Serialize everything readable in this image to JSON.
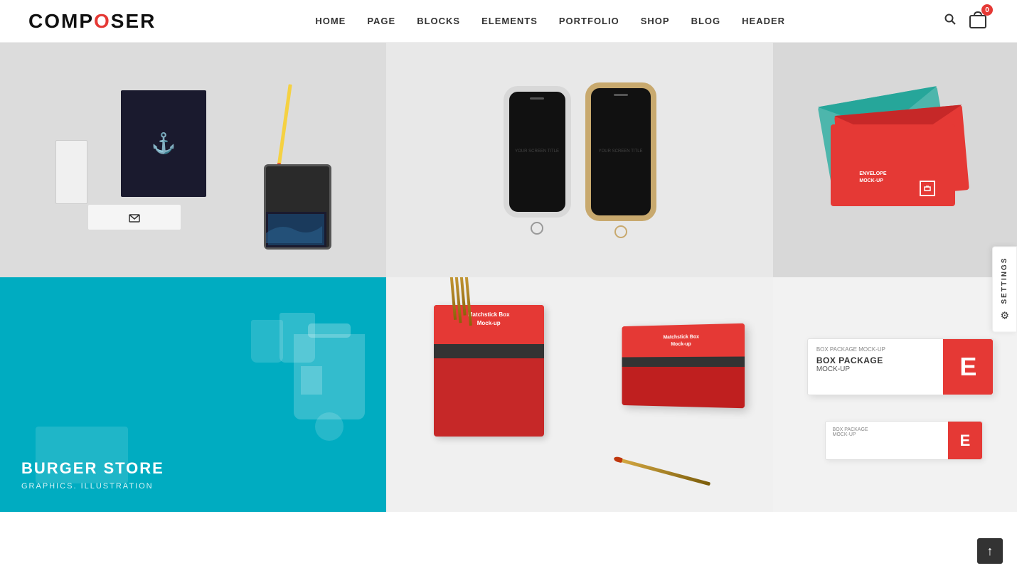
{
  "header": {
    "logo": "COMPOSER",
    "logo_o_color": "#e53935",
    "nav": [
      {
        "label": "HOME",
        "href": "#"
      },
      {
        "label": "PAGE",
        "href": "#"
      },
      {
        "label": "BLOCKS",
        "href": "#"
      },
      {
        "label": "ELEMENTS",
        "href": "#"
      },
      {
        "label": "PORTFOLIO",
        "href": "#"
      },
      {
        "label": "SHOP",
        "href": "#"
      },
      {
        "label": "BLOG",
        "href": "#"
      },
      {
        "label": "HEADER",
        "href": "#"
      }
    ],
    "cart_count": "0"
  },
  "grid": {
    "items": [
      {
        "id": "branding",
        "type": "image",
        "position": "top-left",
        "bg_color": "#dcdcdc"
      },
      {
        "id": "phones",
        "type": "image",
        "position": "top-center",
        "bg_color": "#e8e8e8",
        "phone_label": "YOUR SCREEN TITLE"
      },
      {
        "id": "envelope",
        "type": "image",
        "position": "top-right",
        "bg_color": "#d8d8d8",
        "label_line1": "ENVELOPE",
        "label_line2": "MOCK-UP"
      },
      {
        "id": "burger",
        "type": "image-overlay",
        "position": "bottom-left",
        "bg_color": "#00acc1",
        "title": "BURGER STORE",
        "subtitle": "GRAPHICS. ILLUSTRATION"
      },
      {
        "id": "matchstick",
        "type": "image",
        "position": "bottom-center",
        "bg_color": "#f0f0f0",
        "label": "Matchstick Box\nMock-up"
      },
      {
        "id": "boxpackage",
        "type": "image",
        "position": "bottom-right",
        "bg_color": "#f2f2f2",
        "label_line1": "BOX PACKAGE",
        "label_line2": "MOCK-UP",
        "label_small": "BOX PACKAGE\nMOCK-UP"
      }
    ]
  },
  "settings": {
    "label": "SETTINGS"
  },
  "scroll_top": {
    "label": "↑"
  }
}
